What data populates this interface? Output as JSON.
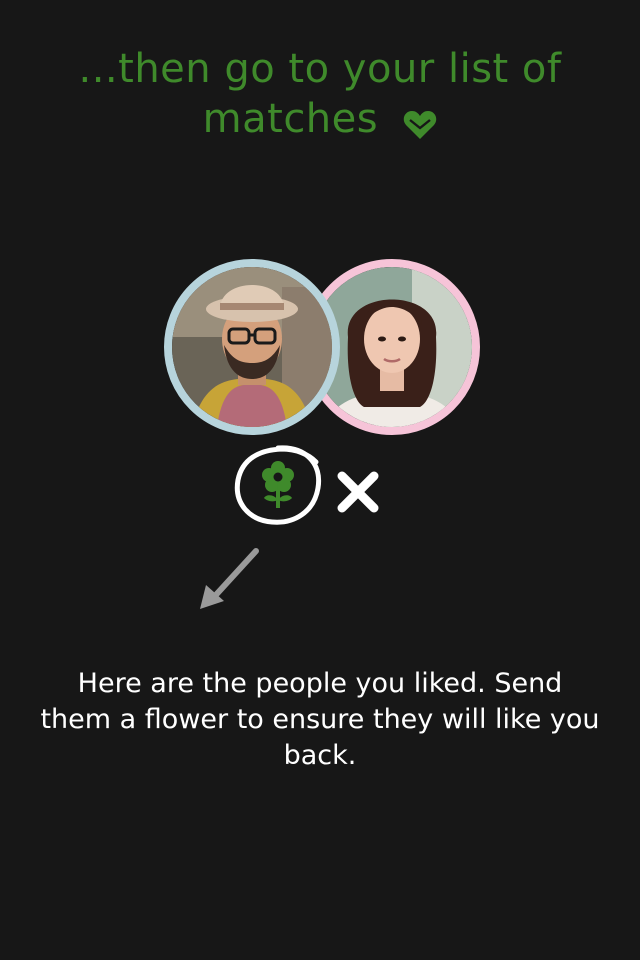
{
  "headline": {
    "text": "...then go to your list of matches",
    "icon": "heart-icon",
    "color": "#3f8a2b"
  },
  "profiles": [
    {
      "name": "",
      "icon": "male-avatar",
      "ring_color": "#b7d4dc"
    },
    {
      "name": "",
      "icon": "female-avatar",
      "ring_color": "#f6c4d8"
    }
  ],
  "actions": {
    "flower": {
      "icon": "flower-icon",
      "color": "#3f8a2b"
    },
    "dismiss": {
      "icon": "close-icon",
      "color": "#ffffff"
    }
  },
  "caption": {
    "text": "Here are the people you liked. Send them a flower to ensure they will like you back."
  },
  "colors": {
    "background": "#171717",
    "accent": "#3f8a2b"
  }
}
